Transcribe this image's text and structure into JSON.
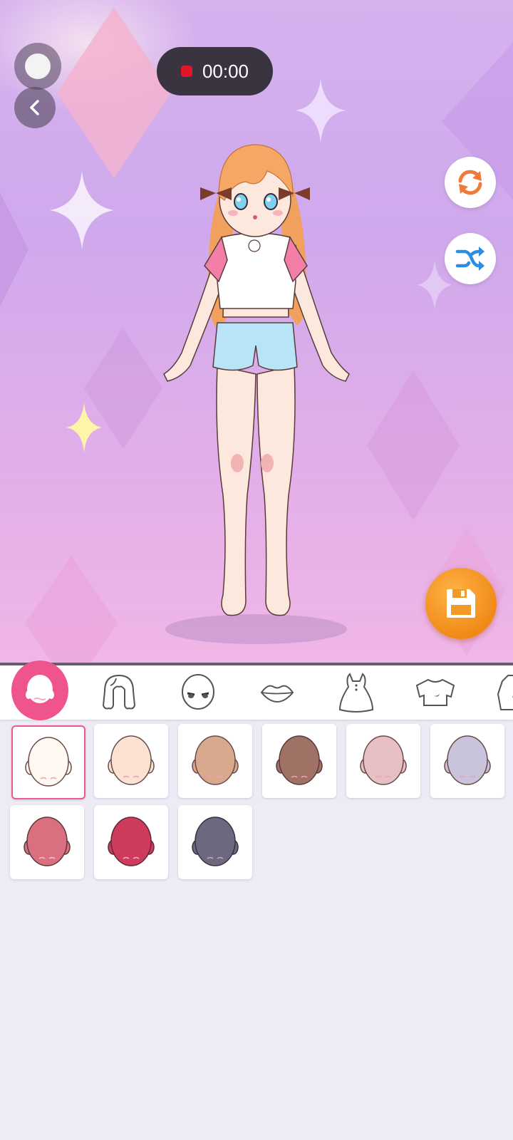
{
  "recording": {
    "timer_text": "00:00"
  },
  "controls": {
    "record_icon": "record-dot-icon",
    "back_icon": "chevron-left-icon",
    "reset_icon": "refresh-icon",
    "random_icon": "shuffle-icon",
    "save_icon": "floppy-disk-icon"
  },
  "categories": [
    {
      "name": "skin",
      "icon": "face-icon",
      "selected": true
    },
    {
      "name": "hair",
      "icon": "hair-icon"
    },
    {
      "name": "eyes",
      "icon": "eyes-icon"
    },
    {
      "name": "mouth",
      "icon": "lips-icon"
    },
    {
      "name": "dress",
      "icon": "dress-icon"
    },
    {
      "name": "top",
      "icon": "shirt-icon"
    },
    {
      "name": "outerwear",
      "icon": "jacket-icon"
    }
  ],
  "skin_tones": [
    {
      "color": "#fff9f2",
      "selected": true
    },
    {
      "color": "#fbe2d2"
    },
    {
      "color": "#d8a98c"
    },
    {
      "color": "#a07266"
    },
    {
      "color": "#e6c0c2"
    },
    {
      "color": "#c9c3db"
    },
    {
      "color": "#d96f7f"
    },
    {
      "color": "#cf3b5c"
    },
    {
      "color": "#6b6880"
    }
  ],
  "colors": {
    "accent": "#f0548d",
    "save": "#f08a17",
    "timer_bg": "#3a3440"
  }
}
